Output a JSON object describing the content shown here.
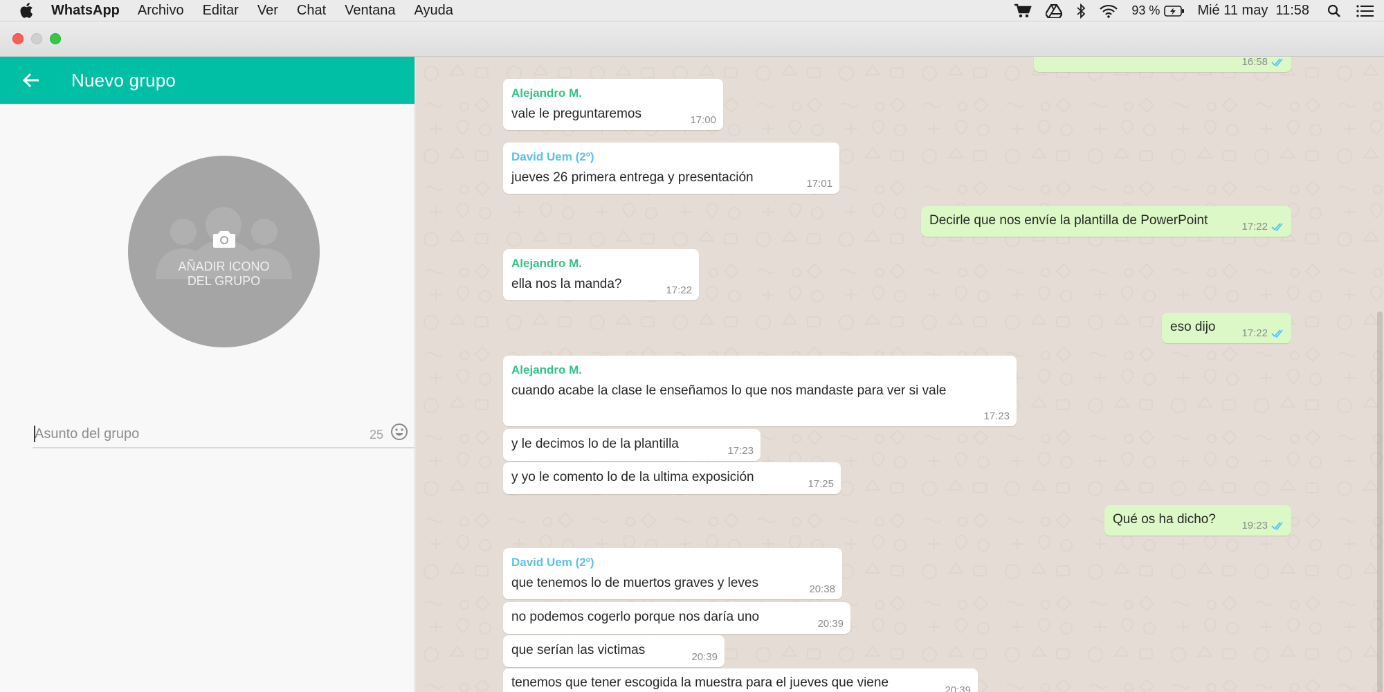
{
  "menubar": {
    "app_name": "WhatsApp",
    "items": [
      "Archivo",
      "Editar",
      "Ver",
      "Chat",
      "Ventana",
      "Ayuda"
    ],
    "battery": "93 %",
    "datetime": "Mié 11 may  11:58",
    "icons": [
      "apple-icon",
      "cart-icon",
      "google-drive-icon",
      "bluetooth-icon",
      "wifi-icon",
      "battery-icon",
      "spotlight-search-icon",
      "notification-center-icon"
    ]
  },
  "left_panel": {
    "title": "Nuevo grupo",
    "avatar_label_line1": "AÑADIR ICONO",
    "avatar_label_line2": "DEL GRUPO",
    "subject_placeholder": "Asunto del grupo",
    "char_counter": "25"
  },
  "colors": {
    "header": "#00bfa5",
    "sender_alejandro": "#35c18a",
    "sender_david": "#5bc2e0",
    "outgoing_bubble": "#dcf8c6",
    "read_ticks": "#4fc3f7"
  },
  "messages": [
    {
      "text": "",
      "time": "16:58"
    },
    {
      "sender": "Alejandro M.",
      "text": "vale le preguntaremos",
      "time": "17:00"
    },
    {
      "sender": "David Uem (2º)",
      "text": "jueves 26 primera entrega y presentación",
      "time": "17:01"
    },
    {
      "text": "Decirle que nos envíe la plantilla de PowerPoint",
      "time": "17:22"
    },
    {
      "sender": "Alejandro M.",
      "text": "ella nos la manda?",
      "time": "17:22"
    },
    {
      "text": "eso dijo",
      "time": "17:22"
    },
    {
      "sender": "Alejandro M.",
      "text": "cuando acabe la clase le enseñamos lo que nos mandaste para ver si vale",
      "time": "17:23"
    },
    {
      "text": "y le decimos lo de la plantilla",
      "time": "17:23"
    },
    {
      "text": "y yo le comento lo de la ultima exposición",
      "time": "17:25"
    },
    {
      "text": "Qué os ha dicho?",
      "time": "19:23"
    },
    {
      "sender": "David Uem (2º)",
      "text": "que tenemos lo de muertos graves y leves",
      "time": "20:38"
    },
    {
      "text": "no podemos cogerlo porque nos daría uno",
      "time": "20:39"
    },
    {
      "text": "que serían las victimas",
      "time": "20:39"
    },
    {
      "text": "tenemos que tener escogida la muestra para el jueves que viene",
      "time": "20:39"
    }
  ]
}
